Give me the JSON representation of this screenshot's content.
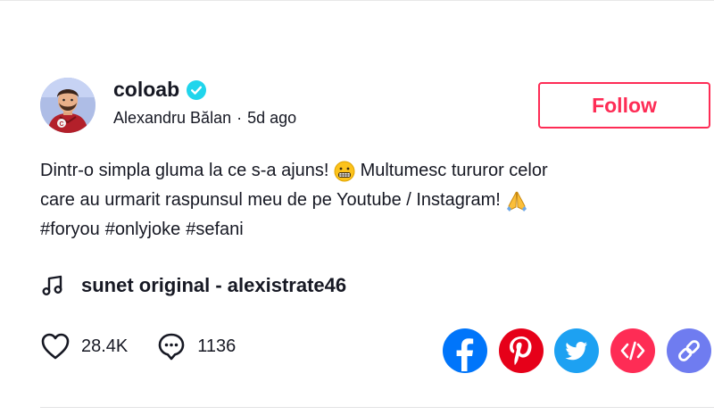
{
  "post": {
    "username": "coloab",
    "display_name": "Alexandru Bălan",
    "separator": "·",
    "time_ago": "5d ago",
    "follow_label": "Follow",
    "description_line1": "Dintr-o simpla gluma la ce s-a ajuns! ",
    "description_line1b": " Multumesc tururor celor",
    "description_line2": "care au urmarit raspunsul meu de pe Youtube / Instagram! ",
    "hashtags": [
      "#foryou",
      "#onlyjoke",
      "#sefani"
    ],
    "music": "sunet original - alexistrate46",
    "likes": "28.4K",
    "comments": "1136"
  },
  "icons": {
    "verified": "verified-badge-icon",
    "music": "music-note-icon",
    "like": "heart-icon",
    "comment": "comment-icon",
    "share_facebook": "facebook-icon",
    "share_pinterest": "pinterest-icon",
    "share_twitter": "twitter-icon",
    "share_embed": "embed-code-icon",
    "share_link": "link-icon"
  },
  "colors": {
    "accent": "#fe2c55",
    "verified": "#20d5ec",
    "facebook": "#0075fa",
    "pinterest": "#e60019",
    "twitter": "#1da1f2",
    "embed": "#fe2c55",
    "link": "#6f7cf0"
  }
}
